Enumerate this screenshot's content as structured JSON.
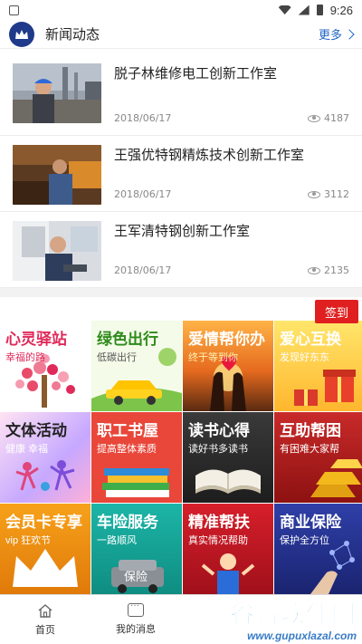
{
  "status_bar": {
    "time": "9:26"
  },
  "header": {
    "title": "新闻动态",
    "more_label": "更多"
  },
  "news": [
    {
      "title": "脱子林维修电工创新工作室",
      "date": "2018/06/17",
      "views": "4187"
    },
    {
      "title": "王强优特钢精炼技术创新工作室",
      "date": "2018/06/17",
      "views": "3112"
    },
    {
      "title": "王军清特钢创新工作室",
      "date": "2018/06/17",
      "views": "2135"
    }
  ],
  "signin_label": "签到",
  "tiles": [
    {
      "title": "心灵驿站",
      "sub": "幸福的路",
      "title_color": "#e02a5a",
      "sub_color": "#e02a5a"
    },
    {
      "title": "绿色出行",
      "sub": "低碳出行",
      "title_color": "#2e8b1a",
      "sub_color": "#555555"
    },
    {
      "title": "爱情帮你办",
      "sub": "终于等到你",
      "title_color": "#ffffff",
      "sub_color": "#fff1b0"
    },
    {
      "title": "爱心互换",
      "sub": "发现好东东",
      "title_color": "#ffffff",
      "sub_color": "#ffffff"
    },
    {
      "title": "文体活动",
      "sub": "健康 幸福",
      "title_color": "#222222",
      "sub_color": "#ffffff"
    },
    {
      "title": "职工书屋",
      "sub": "提高整体素质",
      "title_color": "#ffffff",
      "sub_color": "#ffffff"
    },
    {
      "title": "读书心得",
      "sub": "读好书多读书",
      "title_color": "#ffffff",
      "sub_color": "#ffffff"
    },
    {
      "title": "互助帮困",
      "sub": "有困难大家帮",
      "title_color": "#ffffff",
      "sub_color": "#ffffff"
    },
    {
      "title": "会员卡专享",
      "sub": "vip 狂欢节",
      "title_color": "#ffffff",
      "sub_color": "#ffffff"
    },
    {
      "title": "车险服务",
      "sub": "一路顺风",
      "title_color": "#ffffff",
      "sub_color": "#ffffff"
    },
    {
      "title": "精准帮扶",
      "sub": "真实情况帮助",
      "title_color": "#ffffff",
      "sub_color": "#ffffff"
    },
    {
      "title": "商业保险",
      "sub": "保护全方位",
      "title_color": "#ffffff",
      "sub_color": "#ffffff"
    }
  ],
  "tile_badge": "保险",
  "bottom_nav": [
    {
      "label": "首页"
    },
    {
      "label": "我的消息"
    }
  ],
  "watermark": {
    "name": "谷普软件园",
    "url": "www.gupuxlazal.com"
  }
}
